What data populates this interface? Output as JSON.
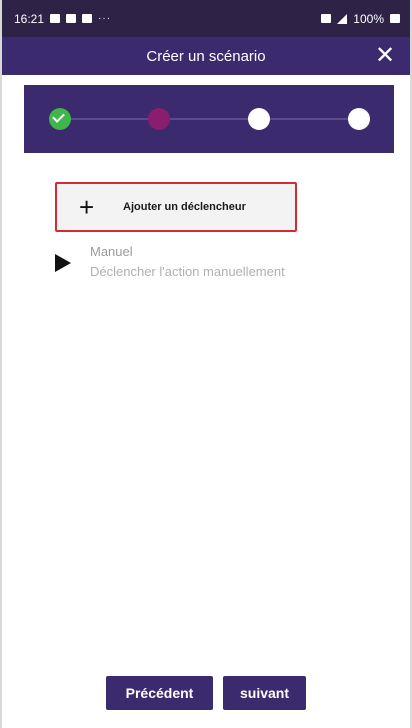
{
  "status_bar": {
    "time": "16:21",
    "dots": "···",
    "battery": "100%"
  },
  "header": {
    "title": "Créer un scénario",
    "close_glyph": "✕"
  },
  "stepper": {
    "steps": [
      {
        "state": "completed",
        "color": "#3fb54a"
      },
      {
        "state": "current",
        "color": "#8a1d6e"
      },
      {
        "state": "pending",
        "color": "#ffffff"
      },
      {
        "state": "pending",
        "color": "#ffffff"
      }
    ]
  },
  "add_trigger": {
    "plus_glyph": "+",
    "label": "Ajouter un déclencheur",
    "highlight_color": "#d42b35"
  },
  "trigger": {
    "name": "Manuel",
    "description": "Déclencher l'action manuellement"
  },
  "footer": {
    "prev_label": "Précédent",
    "next_label": "suivant"
  },
  "colors": {
    "brand": "#3b2a6d",
    "status_bar": "#2e2246"
  }
}
